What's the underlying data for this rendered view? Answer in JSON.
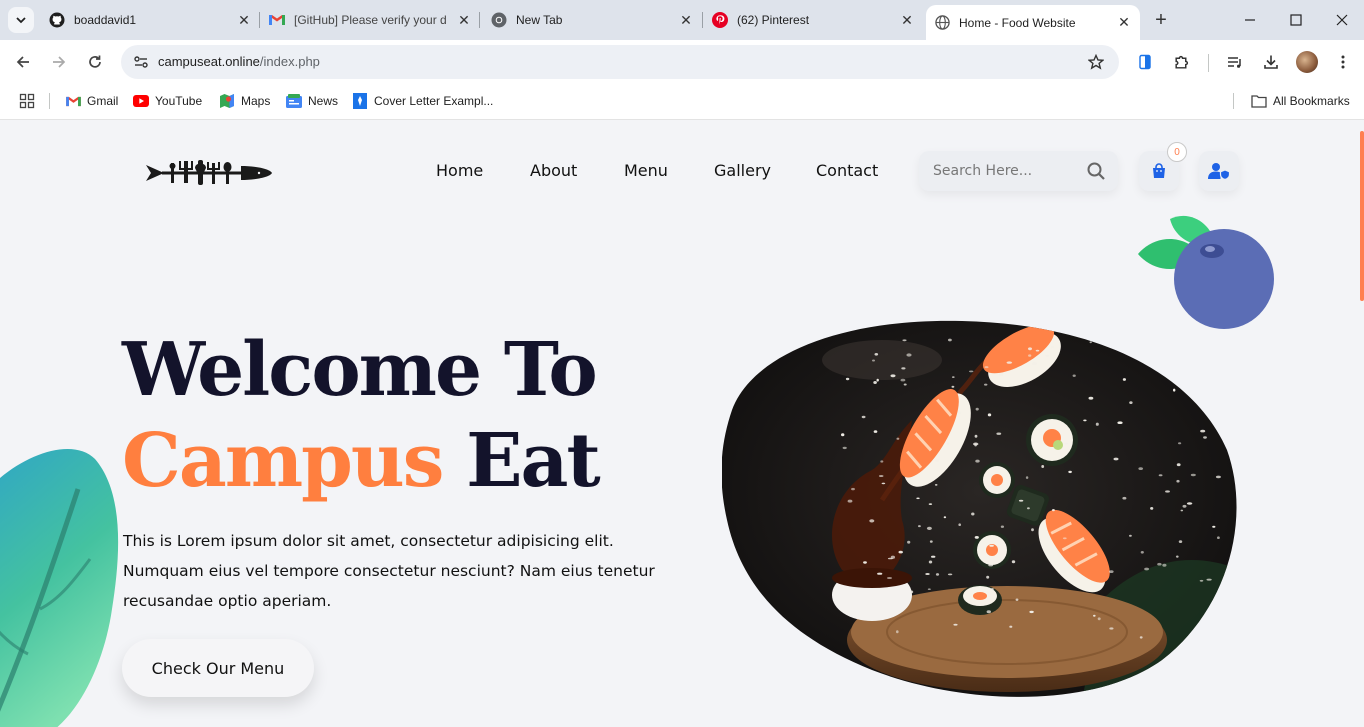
{
  "browser": {
    "tabs": [
      {
        "title": "boaddavid1",
        "icon": "github-icon"
      },
      {
        "title": "[GitHub] Please verify your d",
        "icon": "gmail-icon"
      },
      {
        "title": "New Tab",
        "icon": "chrome-icon"
      },
      {
        "title": "(62) Pinterest",
        "icon": "pinterest-icon"
      },
      {
        "title": "Home - Food Website",
        "icon": "globe-icon",
        "active": true
      }
    ],
    "url_host": "campuseat.online",
    "url_path": "/index.php",
    "bookmarks": [
      {
        "label": "Gmail",
        "icon": "gmail-icon"
      },
      {
        "label": "YouTube",
        "icon": "youtube-icon"
      },
      {
        "label": "Maps",
        "icon": "maps-icon"
      },
      {
        "label": "News",
        "icon": "news-icon"
      },
      {
        "label": "Cover Letter Exampl...",
        "icon": "doc-icon"
      }
    ],
    "all_bookmarks": "All Bookmarks"
  },
  "site": {
    "nav": [
      "Home",
      "About",
      "Menu",
      "Gallery",
      "Contact"
    ],
    "search_placeholder": "Search Here...",
    "cart_count": "0",
    "hero": {
      "title_line1": "Welcome To",
      "title_accent": "Campus",
      "title_rest": "Eat",
      "description": "This is Lorem ipsum dolor sit amet, consectetur adipisicing elit. Numquam eius vel tempore consectetur nesciunt? Nam eius tenetur recusandae optio aperiam.",
      "cta": "Check Our Menu"
    },
    "colors": {
      "accent": "#ff7f3f",
      "dark": "#13132b",
      "blueberry": "#5b6db5",
      "leaf": "#3fae6a"
    }
  }
}
